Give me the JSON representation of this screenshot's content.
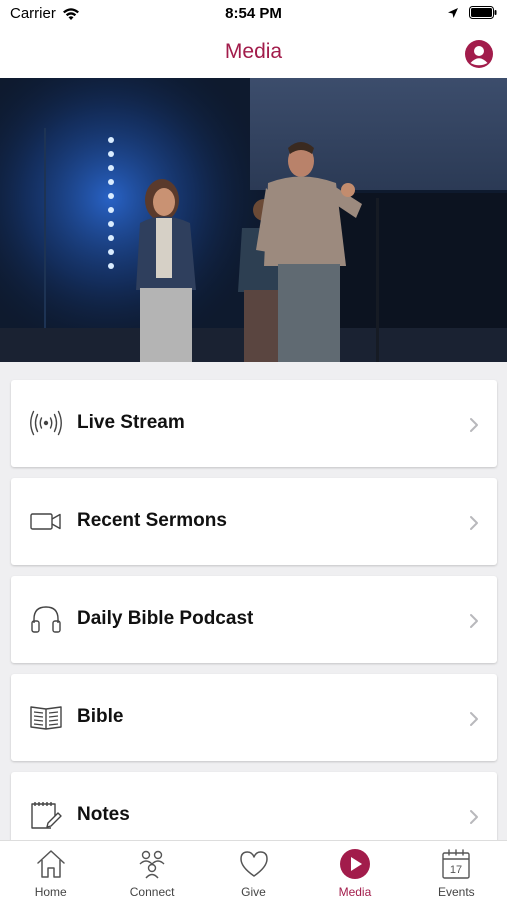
{
  "status_bar": {
    "carrier": "Carrier",
    "time": "8:54 PM"
  },
  "header": {
    "title": "Media",
    "accent_color": "#a21c4b"
  },
  "menu": [
    {
      "label": "Live Stream",
      "icon": "live-stream-icon"
    },
    {
      "label": "Recent Sermons",
      "icon": "video-camera-icon"
    },
    {
      "label": "Daily Bible Podcast",
      "icon": "headphones-icon"
    },
    {
      "label": "Bible",
      "icon": "book-icon"
    },
    {
      "label": "Notes",
      "icon": "notes-icon"
    }
  ],
  "tabs": [
    {
      "label": "Home",
      "icon": "home-icon"
    },
    {
      "label": "Connect",
      "icon": "people-icon"
    },
    {
      "label": "Give",
      "icon": "heart-icon"
    },
    {
      "label": "Media",
      "icon": "play-icon",
      "active": true
    },
    {
      "label": "Events",
      "icon": "calendar-icon"
    }
  ]
}
